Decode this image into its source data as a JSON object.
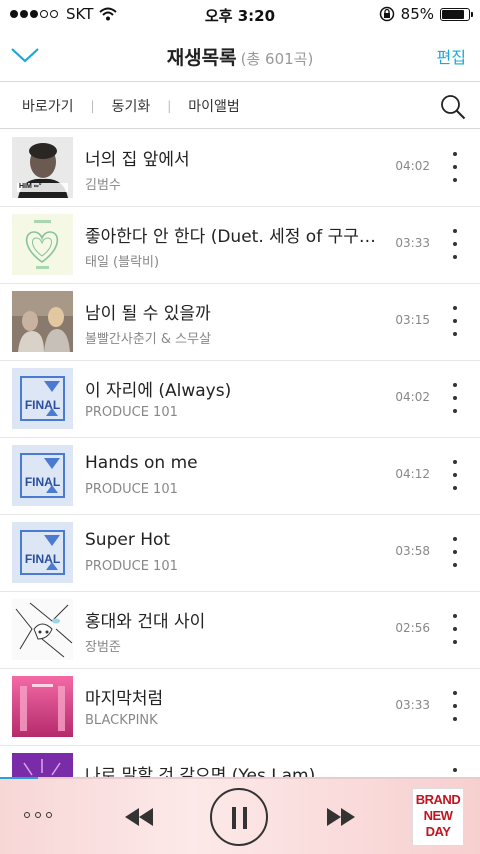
{
  "status_bar": {
    "carrier": "SKT",
    "time": "오후 3:20",
    "battery": "85%",
    "battery_level": 0.85,
    "icons": [
      "signal-dots-icon",
      "wifi-icon",
      "orientation-lock-icon",
      "battery-icon"
    ]
  },
  "header": {
    "title": "재생목록",
    "count": "(총 601곡)",
    "edit_label": "편집",
    "back_icon": "chevron-down-icon"
  },
  "toolbar": {
    "items": [
      "바로가기",
      "동기화",
      "마이앨범"
    ],
    "search_icon": "search-icon"
  },
  "songs": [
    {
      "title": "너의 집 앞에서",
      "artist": "김범수",
      "duration": "04:02",
      "art": "portrait",
      "art_text": "HIM ∞°"
    },
    {
      "title": "좋아한다 안 한다 (Duet. 세정 of 구구단)",
      "artist": "태일 (블락비)",
      "duration": "03:33",
      "art": "heart",
      "art_text": ""
    },
    {
      "title": "남이 될 수 있을까",
      "artist": "볼빨간사춘기 & 스무살",
      "duration": "03:15",
      "art": "photo",
      "art_text": ""
    },
    {
      "title": "이 자리에 (Always)",
      "artist": "PRODUCE 101",
      "duration": "04:02",
      "art": "final",
      "art_text": "FINAL"
    },
    {
      "title": "Hands on me",
      "artist": "PRODUCE 101",
      "duration": "04:12",
      "art": "final",
      "art_text": "FINAL"
    },
    {
      "title": "Super Hot",
      "artist": "PRODUCE 101",
      "duration": "03:58",
      "art": "final",
      "art_text": "FINAL"
    },
    {
      "title": "홍대와 건대 사이",
      "artist": "장범준",
      "duration": "02:56",
      "art": "sketch",
      "art_text": ""
    },
    {
      "title": "마지막처럼",
      "artist": "BLACKPINK",
      "duration": "03:33",
      "art": "pink",
      "art_text": ""
    },
    {
      "title": "나로 말할 것 같으면 (Yes I am)",
      "artist": "",
      "duration": "",
      "art": "purple",
      "art_text": ""
    }
  ],
  "player": {
    "progress": 0.08,
    "accent": "#2a9fd8",
    "cover_text": "BRAND NEW DAY",
    "icons": [
      "more-list-icon",
      "previous-icon",
      "pause-icon",
      "next-icon"
    ]
  },
  "colors": {
    "accent": "#1aa9d6",
    "divider": "#d8d8d8"
  }
}
